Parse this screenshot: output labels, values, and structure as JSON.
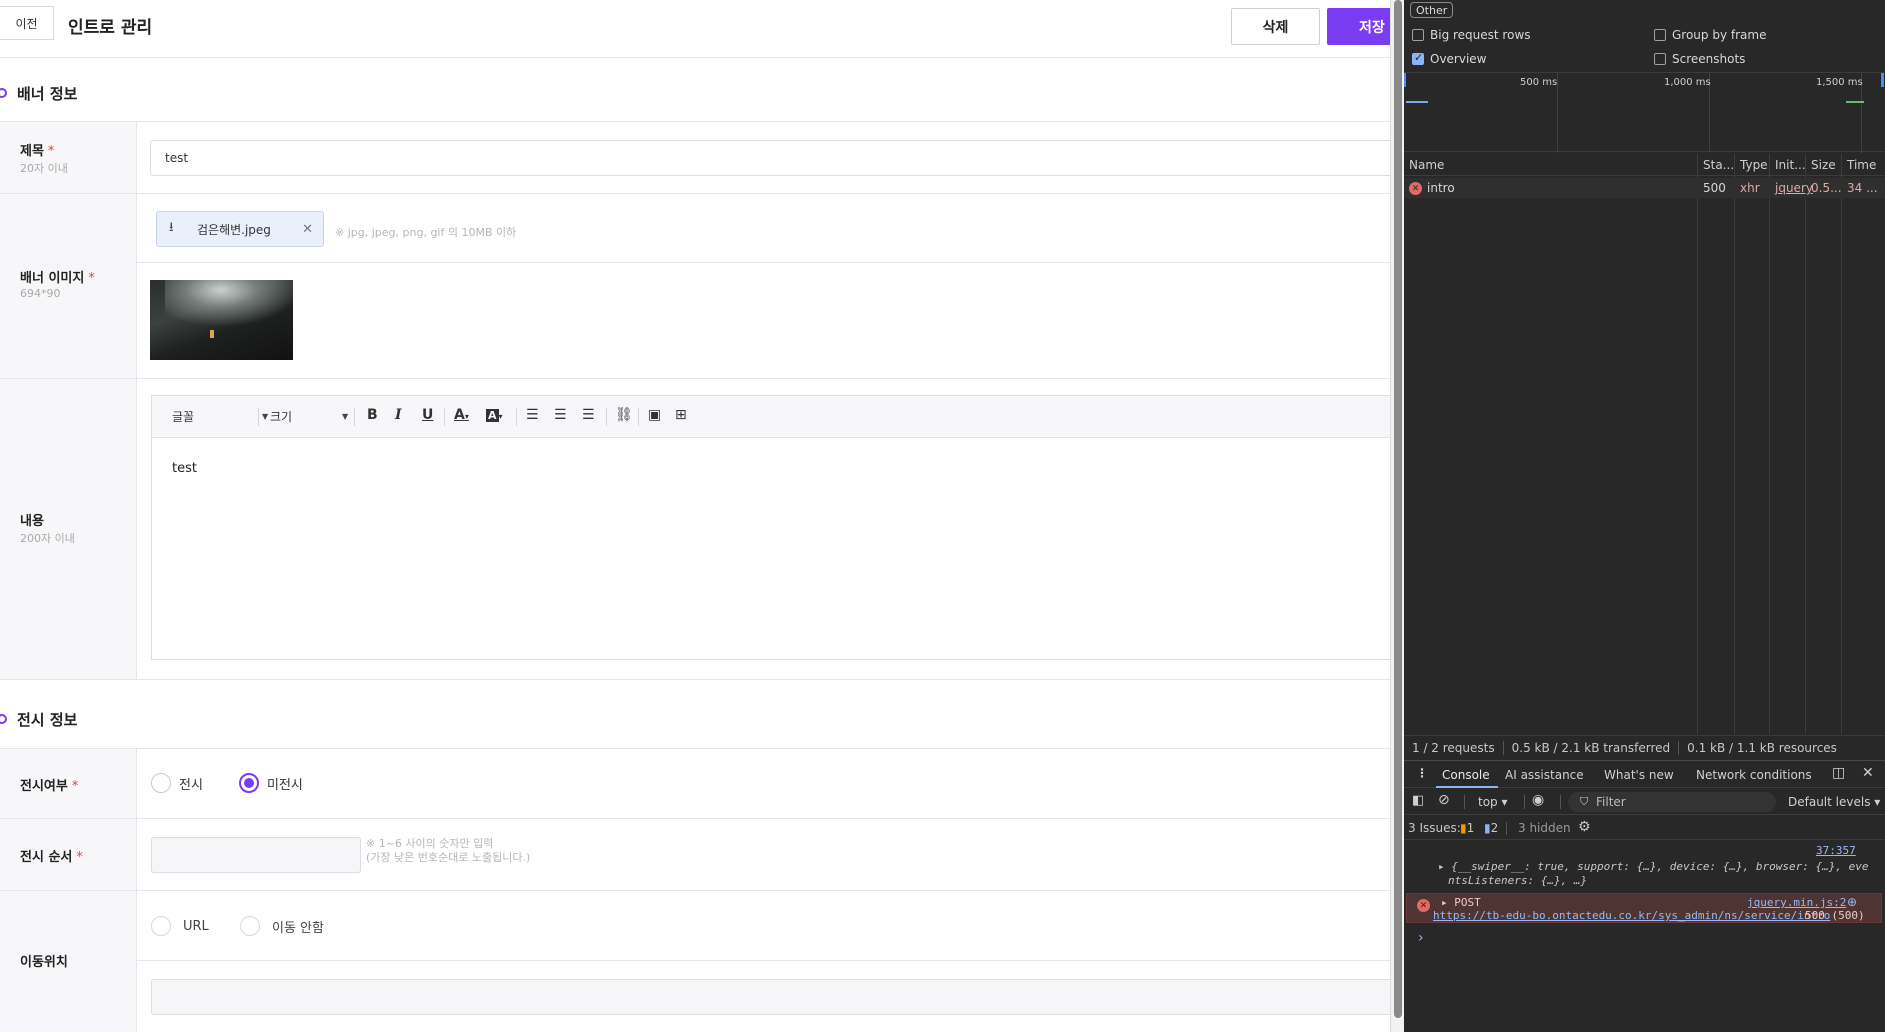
{
  "app": {
    "back_label": "이전",
    "page_title": "인트로 관리",
    "delete_label": "삭제",
    "save_label": "저장",
    "banner_section": "배너 정보",
    "title_label": "제목",
    "title_limit": "20자 이내",
    "title_value": "test",
    "image_label": "배너 이미지",
    "image_size": "694*90",
    "file_name": "검은해변.jpeg",
    "file_hint": "※ jpg, jpeg, png, gif 의 10MB 이하",
    "content_label": "내용",
    "content_limit": "200자 이내",
    "editor": {
      "font_select": "글꼴",
      "size_select": "크기",
      "body_text": "test"
    },
    "display_section": "전시 정보",
    "display_label": "전시여부",
    "display_on": "전시",
    "display_off": "미전시",
    "display_selected": "미전시",
    "order_label": "전시 순서",
    "order_hint_1": "※ 1~6 사이의 숫자만 입력",
    "order_hint_2": "(가장 낮은 번호순대로 노출됩니다.)",
    "move_label": "이동위치",
    "move_url": "URL",
    "move_none": "이동 안함",
    "required_mark": "*"
  },
  "devtools": {
    "filter_chip": "Other",
    "options": {
      "big_rows": "Big request rows",
      "group_by_frame": "Group by frame",
      "overview": "Overview",
      "screenshots": "Screenshots"
    },
    "timeline": {
      "t1": "500 ms",
      "t2": "1,000 ms",
      "t3": "1,500 ms"
    },
    "columns": {
      "name": "Name",
      "status": "Sta...",
      "type": "Type",
      "init": "Init...",
      "size": "Size",
      "time": "Time"
    },
    "request": {
      "name": "intro",
      "status": "500",
      "type": "xhr",
      "initiator": "jquery",
      "size": "0.5...",
      "time": "34 ..."
    },
    "summary": {
      "requests": "1 / 2 requests",
      "transferred": "0.5 kB / 2.1 kB transferred",
      "resources": "0.1 kB / 1.1 kB resources"
    },
    "drawer_tabs": [
      "Console",
      "AI assistance",
      "What's new",
      "Network conditions"
    ],
    "console": {
      "context": "top",
      "filter_placeholder": "Filter",
      "levels": "Default levels",
      "issues_label": "3 Issues:",
      "issues_warn": "1",
      "issues_info": "2",
      "hidden": "3 hidden",
      "log_source": "37:357",
      "log_line1": "▸ {__swiper__: true, support: {…}, device: {…}, browser: {…}, eve",
      "log_line2": "ntsListeners: {…}, …}",
      "post_label": "▸ POST",
      "post_source": "jquery.min.js:2",
      "post_url": "https://tb-edu-bo.ontactedu.co.kr/sys_admin/ns/service/intro",
      "post_status": "500 (500)",
      "prompt": "›"
    }
  }
}
